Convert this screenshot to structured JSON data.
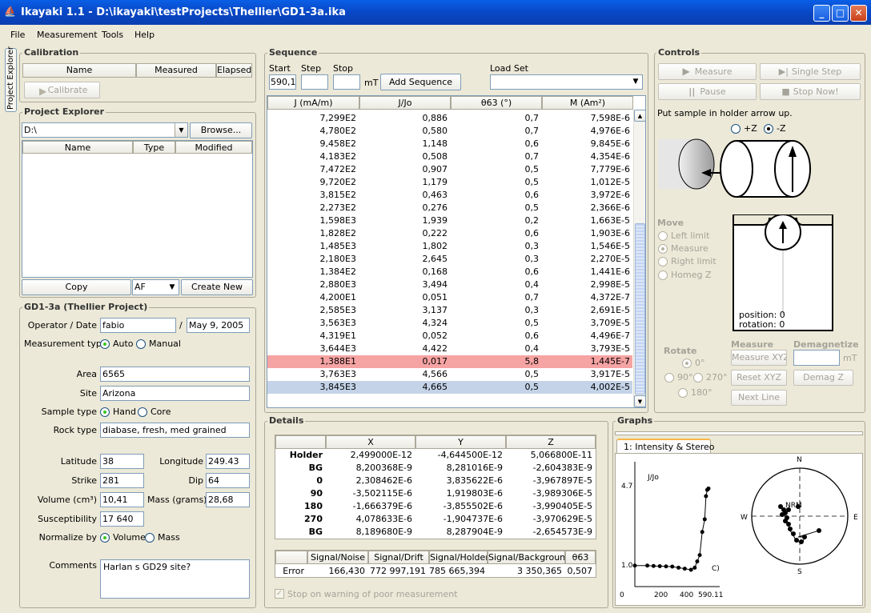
{
  "window": {
    "title": "Ikayaki 1.1 - D:\\ikayaki\\testProjects\\Thellier\\GD1-3a.ika",
    "min": "_",
    "max": "□",
    "close": "✕"
  },
  "menu": [
    "File",
    "Measurement",
    "Tools",
    "Help"
  ],
  "side_tab": "Project Explorer",
  "calibration": {
    "title": "Calibration",
    "columns": [
      "Name",
      "Measured",
      "Elapsed"
    ],
    "button": "Calibrate"
  },
  "explorer": {
    "title": "Project Explorer",
    "path": "D:\\",
    "browse": "Browse...",
    "columns": [
      "Name",
      "Type",
      "Modified"
    ],
    "copy": "Copy",
    "type_value": "AF",
    "create": "Create New"
  },
  "project": {
    "title": "GD1-3a (Thellier Project)",
    "operator_label": "Operator / Date",
    "operator": "fabio",
    "slash": "/",
    "date": "May 9, 2005",
    "mtype_label": "Measurement type",
    "auto": "Auto",
    "manual": "Manual",
    "area_label": "Area",
    "area": "6565",
    "site_label": "Site",
    "site": "Arizona",
    "stype_label": "Sample type",
    "hand": "Hand",
    "core": "Core",
    "rock_label": "Rock type",
    "rock": "diabase, fresh, med grained",
    "lat_label": "Latitude",
    "lat": "38",
    "lon_label": "Longitude",
    "lon": "249.43",
    "strike_label": "Strike",
    "strike": "281",
    "dip_label": "Dip",
    "dip": "64",
    "vol_label": "Volume (cm³)",
    "vol": "10,41",
    "mass_label": "Mass (grams)",
    "mass": "28,68",
    "sus_label": "Susceptibility",
    "sus": "17 640",
    "norm_label": "Normalize by",
    "volume": "Volume",
    "massopt": "Mass",
    "comments_label": "Comments",
    "comments": "Harlan s GD29 site?"
  },
  "sequence": {
    "title": "Sequence",
    "start_label": "Start",
    "step_label": "Step",
    "stop_label": "Stop",
    "start": "590,1",
    "unit": "mT",
    "add": "Add Sequence",
    "loadset": "Load Set",
    "columns": [
      "J (mA/m)",
      "J/Jo",
      "θ63 (°)",
      "M (Am²)"
    ],
    "rows": [
      [
        "7,299E2",
        "0,886",
        "0,7",
        "7,598E-6"
      ],
      [
        "4,780E2",
        "0,580",
        "0,7",
        "4,976E-6"
      ],
      [
        "9,458E2",
        "1,148",
        "0,6",
        "9,845E-6"
      ],
      [
        "4,183E2",
        "0,508",
        "0,7",
        "4,354E-6"
      ],
      [
        "7,472E2",
        "0,907",
        "0,5",
        "7,779E-6"
      ],
      [
        "9,720E2",
        "1,179",
        "0,5",
        "1,012E-5"
      ],
      [
        "3,815E2",
        "0,463",
        "0,6",
        "3,972E-6"
      ],
      [
        "2,273E2",
        "0,276",
        "0,5",
        "2,366E-6"
      ],
      [
        "1,598E3",
        "1,939",
        "0,2",
        "1,663E-5"
      ],
      [
        "1,828E2",
        "0,222",
        "0,6",
        "1,903E-6"
      ],
      [
        "1,485E3",
        "1,802",
        "0,3",
        "1,546E-5"
      ],
      [
        "2,180E3",
        "2,645",
        "0,3",
        "2,270E-5"
      ],
      [
        "1,384E2",
        "0,168",
        "0,6",
        "1,441E-6"
      ],
      [
        "2,880E3",
        "3,494",
        "0,4",
        "2,998E-5"
      ],
      [
        "4,200E1",
        "0,051",
        "0,7",
        "4,372E-7"
      ],
      [
        "2,585E3",
        "3,137",
        "0,3",
        "2,691E-5"
      ],
      [
        "3,563E3",
        "4,324",
        "0,5",
        "3,709E-5"
      ],
      [
        "4,319E1",
        "0,052",
        "0,6",
        "4,496E-7"
      ],
      [
        "3,644E3",
        "4,422",
        "0,4",
        "3,793E-5"
      ],
      [
        "1,388E1",
        "0,017",
        "5,8",
        "1,445E-7"
      ],
      [
        "3,763E3",
        "4,566",
        "0,5",
        "3,917E-5"
      ],
      [
        "3,845E3",
        "4,665",
        "0,5",
        "4,002E-5"
      ]
    ],
    "highlight_red_row": 19,
    "highlight_blue_row": 21
  },
  "controls": {
    "title": "Controls",
    "measure": "Measure",
    "single": "Single Step",
    "pause": "Pause",
    "stop": "Stop Now!",
    "instruction": "Put sample in holder arrow up.",
    "pz": "+Z",
    "mz": "-Z",
    "move": "Move",
    "left": "Left limit",
    "measure_opt": "Measure",
    "right": "Right limit",
    "homeg": "Homeg Z",
    "position": "position: 0",
    "rotation": "rotation: 0",
    "rotate": "Rotate",
    "r0": "0°",
    "r90": "90°",
    "r270": "270°",
    "r180": "180°",
    "measure_hdr": "Measure",
    "mxyz": "Measure XYZ",
    "rxyz": "Reset XYZ",
    "next": "Next Line",
    "demag": "Demagnetize",
    "demag_unit": "mT",
    "demagz": "Demag Z"
  },
  "details": {
    "title": "Details",
    "columns": [
      "",
      "X",
      "Y",
      "Z"
    ],
    "rows": [
      [
        "Holder",
        "2,499000E-12",
        "-4,644500E-12",
        "5,066800E-11"
      ],
      [
        "BG",
        "8,200368E-9",
        "8,281016E-9",
        "-2,604383E-9"
      ],
      [
        "0",
        "2,308462E-6",
        "3,835622E-6",
        "-3,967897E-5"
      ],
      [
        "90",
        "-3,502115E-6",
        "1,919803E-6",
        "-3,989306E-5"
      ],
      [
        "180",
        "-1,666379E-6",
        "-3,855502E-6",
        "-3,990405E-5"
      ],
      [
        "270",
        "4,078633E-6",
        "-1,904737E-6",
        "-3,970629E-5"
      ],
      [
        "BG",
        "8,189680E-9",
        "8,287904E-9",
        "-2,654573E-9"
      ]
    ],
    "err_columns": [
      "",
      "Signal/Noise",
      "Signal/Drift",
      "Signal/Holder",
      "Signal/Background",
      "θ63"
    ],
    "err_row": [
      "Error",
      "166,430",
      "772 997,191",
      "785 665,394",
      "3 350,365",
      "0,507"
    ],
    "stopwarn": "Stop on warning of poor measurement"
  },
  "graphs": {
    "title": "Graphs",
    "tab": "1: Intensity & Stereo",
    "ylabel": "J/Jo",
    "yticks": [
      "4.7",
      "1.0"
    ],
    "xticks": [
      "0",
      "200",
      "400",
      "590.11"
    ],
    "note": "C)",
    "stereo": {
      "N": "N",
      "S": "S",
      "E": "E",
      "W": "W",
      "NRM": "NRM"
    }
  },
  "chart_data": {
    "type": "line",
    "ylabel": "J/Jo",
    "yticks": [
      "4.7",
      "1.0"
    ],
    "xticks": [
      "0",
      "200",
      "400",
      "590.11"
    ],
    "x": [
      0,
      100,
      150,
      200,
      250,
      300,
      350,
      400,
      450,
      480,
      500,
      520,
      540,
      560,
      570,
      580,
      590
    ],
    "y": [
      1.0,
      1.0,
      0.98,
      0.97,
      0.96,
      0.95,
      0.9,
      0.85,
      0.8,
      0.9,
      1.2,
      1.5,
      2.6,
      3.2,
      4.3,
      4.6,
      4.665
    ]
  }
}
